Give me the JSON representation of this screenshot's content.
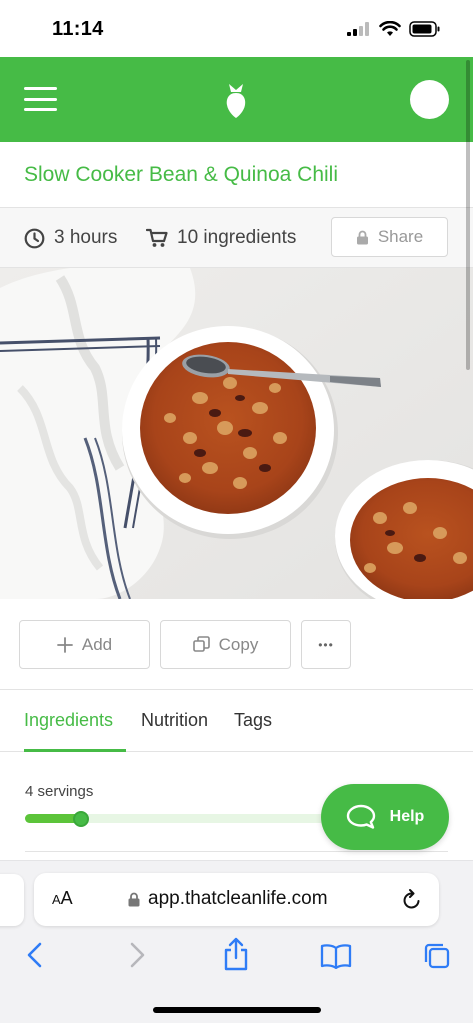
{
  "status_bar": {
    "time": "11:14"
  },
  "header": {
    "brand_icon": "carrot-logo-icon"
  },
  "recipe": {
    "title": "Slow Cooker Bean & Quinoa Chili",
    "time": "3 hours",
    "ingredients_count": "10 ingredients",
    "share_label": "Share"
  },
  "actions": {
    "add_label": "Add",
    "copy_label": "Copy",
    "more_label": "•••"
  },
  "tabs": [
    {
      "label": "Ingredients",
      "active": true
    },
    {
      "label": "Nutrition",
      "active": false
    },
    {
      "label": "Tags",
      "active": false
    }
  ],
  "servings": {
    "label": "4 servings",
    "slider_fraction": 0.17
  },
  "help": {
    "label": "Help"
  },
  "browser": {
    "text_size_small": "A",
    "text_size_large": "A",
    "url": "app.thatcleanlife.com"
  },
  "colors": {
    "brand_green": "#46bb46",
    "ios_blue": "#2f7cf6"
  }
}
